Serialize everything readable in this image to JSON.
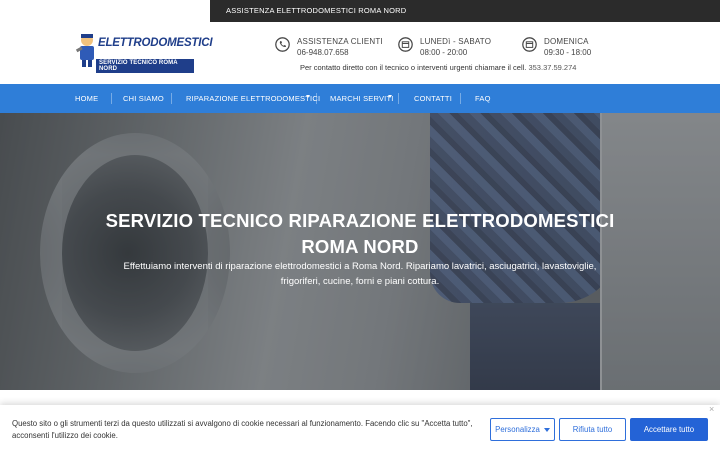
{
  "topbar": {
    "label": "ASSISTENZA ELETTRODOMESTICI ROMA NORD"
  },
  "logo": {
    "brand": "ELETTRODOMESTICI",
    "tagline": "SERVIZIO TECNICO ROMA NORD"
  },
  "header": {
    "support": {
      "title": "ASSISTENZA CLIENTI",
      "value": "06-948.07.658",
      "icon": "phone-icon"
    },
    "weekdays": {
      "title": "LUNEDì - SABATO",
      "value": "08:00 - 20:00",
      "icon": "calendar-icon"
    },
    "sunday": {
      "title": "DOMENICA",
      "value": "09:30 - 18:00",
      "icon": "calendar-icon"
    },
    "direct_text": "Per contatto diretto con il tecnico o interventi urgenti chiamare il cell.",
    "direct_number": "353.37.59.274"
  },
  "nav": {
    "items": [
      {
        "label": "HOME"
      },
      {
        "label": "CHI SIAMO"
      },
      {
        "label": "RIPARAZIONE ELETTRODOMESTICI"
      },
      {
        "label": "MARCHI SERVITI"
      },
      {
        "label": "CONTATTI"
      },
      {
        "label": "FAQ"
      }
    ]
  },
  "hero": {
    "title_line1": "SERVIZIO TECNICO RIPARAZIONE ELETTRODOMESTICI",
    "title_line2": "ROMA NORD",
    "text_line1": "Effettuiamo interventi di riparazione elettrodomestici a Roma Nord. Ripariamo lavatrici, asciugatrici, lavastoviglie,",
    "text_line2": "frigoriferi, cucine, forni e piani cottura."
  },
  "cookie": {
    "text": "Questo sito o gli strumenti terzi da questo utilizzati si avvalgono di cookie necessari al funzionamento. Facendo clic su \"Accetta tutto\", acconsenti l'utilizzo dei cookie.",
    "close": "×",
    "btn_customize": "Personalizza",
    "btn_reject": "Rifiuta tutto",
    "btn_accept": "Accettare tutto"
  },
  "colors": {
    "nav": "#2f7ed8",
    "brand": "#1f3e8a",
    "accept": "#2463d6"
  }
}
